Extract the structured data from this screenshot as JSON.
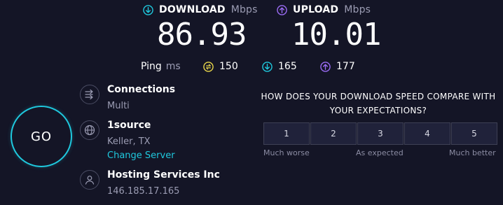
{
  "download": {
    "label": "DOWNLOAD",
    "unit": "Mbps",
    "value": "86.93",
    "icon": "download-arrow-icon",
    "color": "#1fc9de"
  },
  "upload": {
    "label": "UPLOAD",
    "unit": "Mbps",
    "value": "10.01",
    "icon": "upload-arrow-icon",
    "color": "#9b6cf5"
  },
  "ping": {
    "label": "Ping",
    "unit": "ms",
    "idle": {
      "value": "150",
      "icon": "ping-idle-icon",
      "color": "#e9d64a"
    },
    "download": {
      "value": "165",
      "icon": "ping-download-icon",
      "color": "#1fc9de"
    },
    "upload": {
      "value": "177",
      "icon": "ping-upload-icon",
      "color": "#9b6cf5"
    }
  },
  "go_button": {
    "label": "GO"
  },
  "connections": {
    "title": "Connections",
    "value": "Multi",
    "icon": "connections-icon"
  },
  "server": {
    "title": "1source",
    "location": "Keller, TX",
    "change_label": "Change Server",
    "icon": "globe-icon"
  },
  "provider": {
    "title": "Hosting Services Inc",
    "ip": "146.185.17.165",
    "icon": "user-icon"
  },
  "survey": {
    "question_line1": "HOW DOES YOUR DOWNLOAD SPEED COMPARE WITH",
    "question_line2": "YOUR EXPECTATIONS?",
    "options": [
      "1",
      "2",
      "3",
      "4",
      "5"
    ],
    "scale_low": "Much worse",
    "scale_mid": "As expected",
    "scale_high": "Much better"
  },
  "colors": {
    "background": "#141526",
    "accent": "#1fc9de",
    "upload": "#9b6cf5",
    "muted": "#9b9cb3"
  }
}
